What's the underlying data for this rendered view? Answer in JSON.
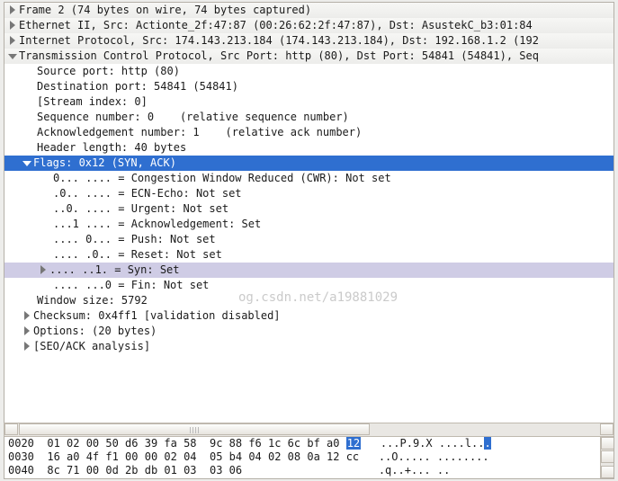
{
  "tree": {
    "frame": "Frame 2 (74 bytes on wire, 74 bytes captured)",
    "eth": "Ethernet II, Src: Actionte_2f:47:87 (00:26:62:2f:47:87), Dst: AsustekC_b3:01:84",
    "ip": "Internet Protocol, Src: 174.143.213.184 (174.143.213.184), Dst: 192.168.1.2 (192",
    "tcp": "Transmission Control Protocol, Src Port: http (80), Dst Port: 54841 (54841), Seq",
    "src_port": "Source port: http (80)",
    "dst_port": "Destination port: 54841 (54841)",
    "stream": "[Stream index: 0]",
    "seq": "Sequence number: 0    (relative sequence number)",
    "ack": "Acknowledgement number: 1    (relative ack number)",
    "hdr_len": "Header length: 40 bytes",
    "flags": "Flags: 0x12 (SYN, ACK)",
    "cwr": "0... .... = Congestion Window Reduced (CWR): Not set",
    "ecn": ".0.. .... = ECN-Echo: Not set",
    "urg": "..0. .... = Urgent: Not set",
    "ackf": "...1 .... = Acknowledgement: Set",
    "psh": ".... 0... = Push: Not set",
    "rst": ".... .0.. = Reset: Not set",
    "syn": ".... ..1. = Syn: Set",
    "fin": ".... ...0 = Fin: Not set",
    "win": "Window size: 5792",
    "chk": "Checksum: 0x4ff1 [validation disabled]",
    "opts": "Options: (20 bytes)",
    "seoack": "[SEO/ACK analysis]"
  },
  "watermark": "og.csdn.net/a19881029",
  "hex": {
    "r0": {
      "off": "0020",
      "b": "01 02 00 50 d6 39 fa 58  9c 88 f6 1c 6c bf a0 ",
      "hb": "12",
      "a": "   ...P.9.X ....l..",
      "ha": "."
    },
    "r1": {
      "off": "0030",
      "b": "16 a0 4f f1 00 00 02 04  05 b4 04 02 08 0a 12 cc",
      "a": "   ..O..... ........"
    },
    "r2": {
      "off": "0040",
      "b": "8c 71 00 0d 2b db 01 03  03 06",
      "a": "                     .q..+... ..      "
    }
  }
}
